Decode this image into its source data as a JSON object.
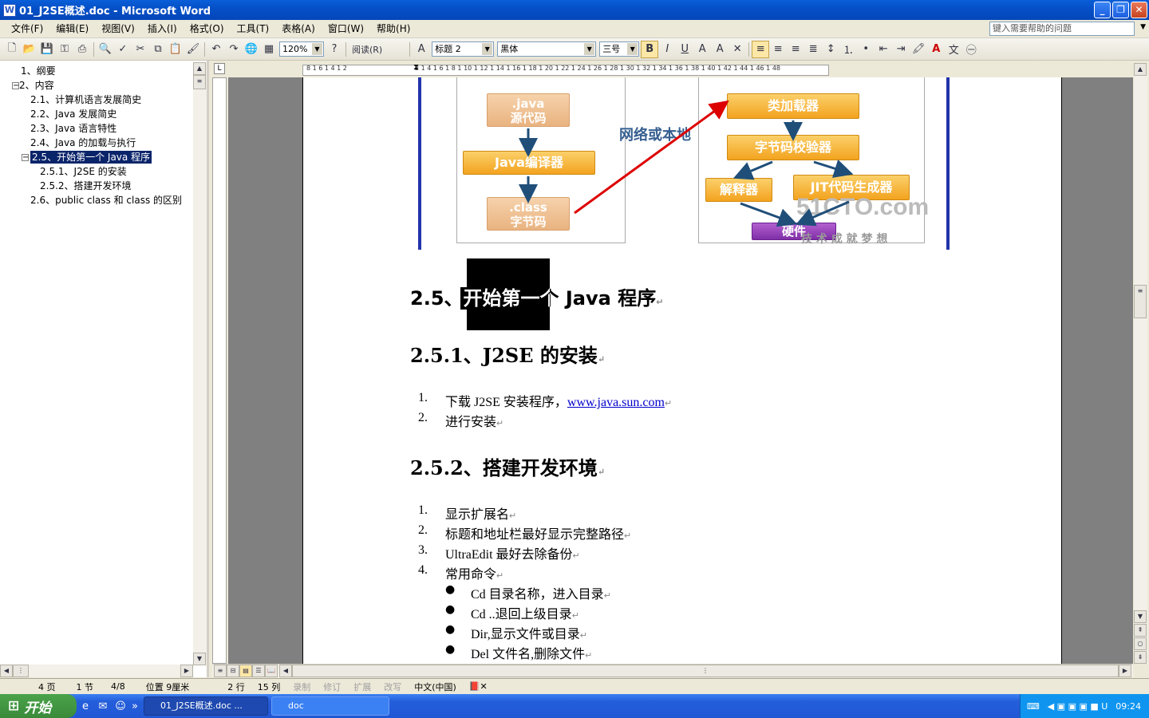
{
  "window": {
    "title": "01_J2SE概述.doc - Microsoft Word"
  },
  "menubar": {
    "items": [
      "文件(F)",
      "编辑(E)",
      "视图(V)",
      "插入(I)",
      "格式(O)",
      "工具(T)",
      "表格(A)",
      "窗口(W)",
      "帮助(H)"
    ],
    "help_placeholder": "键入需要帮助的问题"
  },
  "toolbar": {
    "zoom": "120%",
    "read_label": "阅读(R)",
    "style": "标题 2",
    "font": "黑体",
    "size": "三号"
  },
  "nav": {
    "items": [
      "1、纲要",
      "2、内容",
      "2.1、计算机语言发展简史",
      "2.2、Java 发展简史",
      "2.3、Java 语言特性",
      "2.4、Java 的加载与执行",
      "2.5、开始第一个 Java 程序",
      "2.5.1、J2SE  的安装",
      "2.5.2、搭建开发环境",
      "2.6、public class  和  class 的区别"
    ]
  },
  "diagram": {
    "left_boxes": [
      ".java\n源代码",
      "Java编译器",
      ".class\n字节码"
    ],
    "middle_label": "网络或本地",
    "right_boxes": [
      "类加载器",
      "字节码校验器",
      "解释器",
      "JIT代码生成器",
      "硬件"
    ],
    "watermark": "51CTO.com",
    "watermark_sub": "技 术 成 就 梦 想"
  },
  "document": {
    "h_25": "2.5、开始第一个 Java 程序",
    "h_251": "2.5.1、J2SE  的安装",
    "install_steps": [
      {
        "num": "1.",
        "text": "下载 J2SE 安装程序，",
        "link": "www.java.sun.com"
      },
      {
        "num": "2.",
        "text": "进行安装"
      }
    ],
    "h_252": "2.5.2、搭建开发环境",
    "env_steps": [
      {
        "num": "1.",
        "text": "显示扩展名"
      },
      {
        "num": "2.",
        "text": "标题和地址栏最好显示完整路径"
      },
      {
        "num": "3.",
        "text": "UltraEdit 最好去除备份"
      },
      {
        "num": "4.",
        "text": "常用命令"
      }
    ],
    "bullets": [
      "Cd  目录名称，进入目录",
      "Cd ..退回上级目录",
      "Dir,显示文件或目录",
      "Del  文件名,删除文件"
    ]
  },
  "statusbar": {
    "page": "4 页",
    "section": "1 节",
    "pages": "4/8",
    "position": "位置 9厘米",
    "line": "2 行",
    "col": "15 列",
    "rec": "录制",
    "trk": "修订",
    "ext": "扩展",
    "ovr": "改写",
    "lang": "中文(中国)"
  },
  "taskbar": {
    "start": "开始",
    "tasks": [
      "01_J2SE概述.doc ...",
      "doc"
    ],
    "clock": "09:24"
  }
}
